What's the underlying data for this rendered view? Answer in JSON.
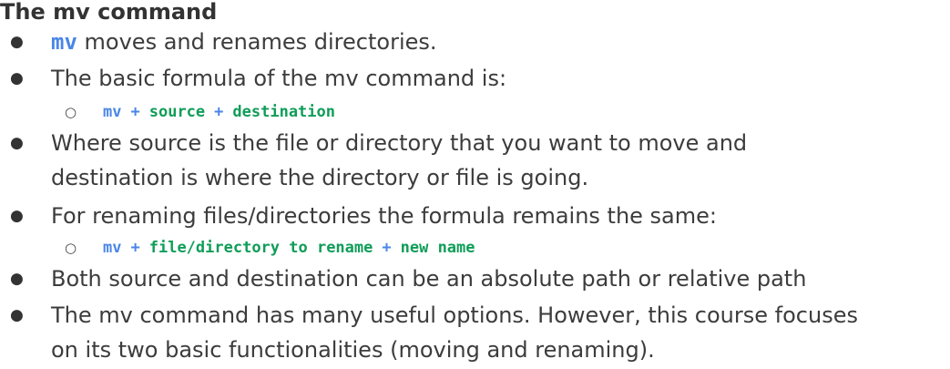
{
  "title": "The mv command",
  "colors": {
    "command_blue": "#4a86e8",
    "code_green": "#0f9d58",
    "text": "#3c3c3c"
  },
  "bullets": [
    {
      "code": "mv",
      "text": " moves and renames directories."
    },
    {
      "text": "The basic formula of the mv command is:"
    },
    {
      "text_line1": "Where source is the file or directory that you want to move and",
      "text_line2": "destination is where the directory or file is going."
    },
    {
      "text": "For renaming files/directories the formula remains the same:"
    },
    {
      "text": "Both source and destination can be an absolute path or relative path"
    },
    {
      "text_line1": "The mv command has many useful options. However, this course focuses",
      "text_line2": "on its two basic functionalities (moving and renaming)."
    }
  ],
  "formulas": {
    "move": {
      "cmd": "mv",
      "plus": "+",
      "arg1": "source",
      "arg2": "destination"
    },
    "rename": {
      "cmd": "mv",
      "plus": "+",
      "arg1": "file/directory to rename",
      "arg2": "new name"
    }
  },
  "icons": {
    "bullet": "●",
    "sub_bullet": "○"
  }
}
